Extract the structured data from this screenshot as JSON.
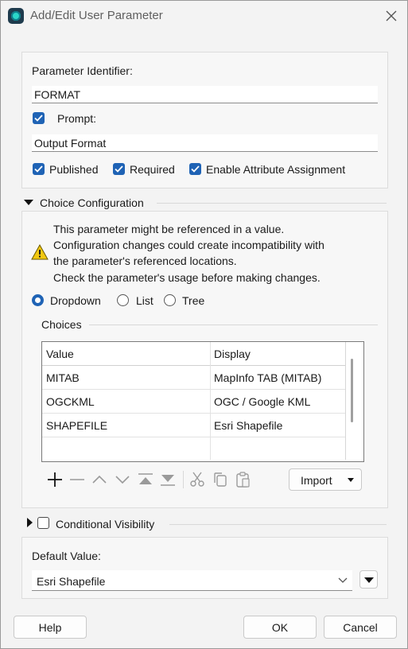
{
  "window": {
    "title": "Add/Edit User Parameter"
  },
  "identifier": {
    "label": "Parameter Identifier:",
    "value": "FORMAT"
  },
  "prompt": {
    "label": "Prompt:",
    "checked": true,
    "value": "Output Format"
  },
  "flags": {
    "published": {
      "label": "Published",
      "checked": true
    },
    "required": {
      "label": "Required",
      "checked": true
    },
    "attribute_assignment": {
      "label": "Enable Attribute Assignment",
      "checked": true
    }
  },
  "choice_config": {
    "header": "Choice Configuration",
    "warning_lines": [
      "This parameter might be referenced in a value.",
      "Configuration changes could create incompatibility with",
      "the parameter's referenced locations.",
      "Check the parameter's usage before making changes."
    ],
    "modes": [
      {
        "label": "Dropdown",
        "selected": true
      },
      {
        "label": "List",
        "selected": false
      },
      {
        "label": "Tree",
        "selected": false
      }
    ],
    "choices_label": "Choices",
    "columns": [
      "Value",
      "Display"
    ],
    "rows": [
      [
        "MITAB",
        "MapInfo TAB (MITAB)"
      ],
      [
        "OGCKML",
        "OGC / Google KML"
      ],
      [
        "SHAPEFILE",
        "Esri Shapefile"
      ]
    ],
    "toolbar_icons": [
      "add-icon",
      "remove-icon",
      "move-up-icon",
      "move-down-icon",
      "move-top-icon",
      "move-bottom-icon",
      "cut-icon",
      "copy-icon",
      "paste-icon"
    ],
    "import_label": "Import"
  },
  "conditional": {
    "label": "Conditional Visibility",
    "checked": false
  },
  "default_value": {
    "label": "Default Value:",
    "value": "Esri Shapefile"
  },
  "footer": {
    "help": "Help",
    "ok": "OK",
    "cancel": "Cancel"
  },
  "colors": {
    "accent": "#1f63b5",
    "warning": "#f2c811"
  }
}
